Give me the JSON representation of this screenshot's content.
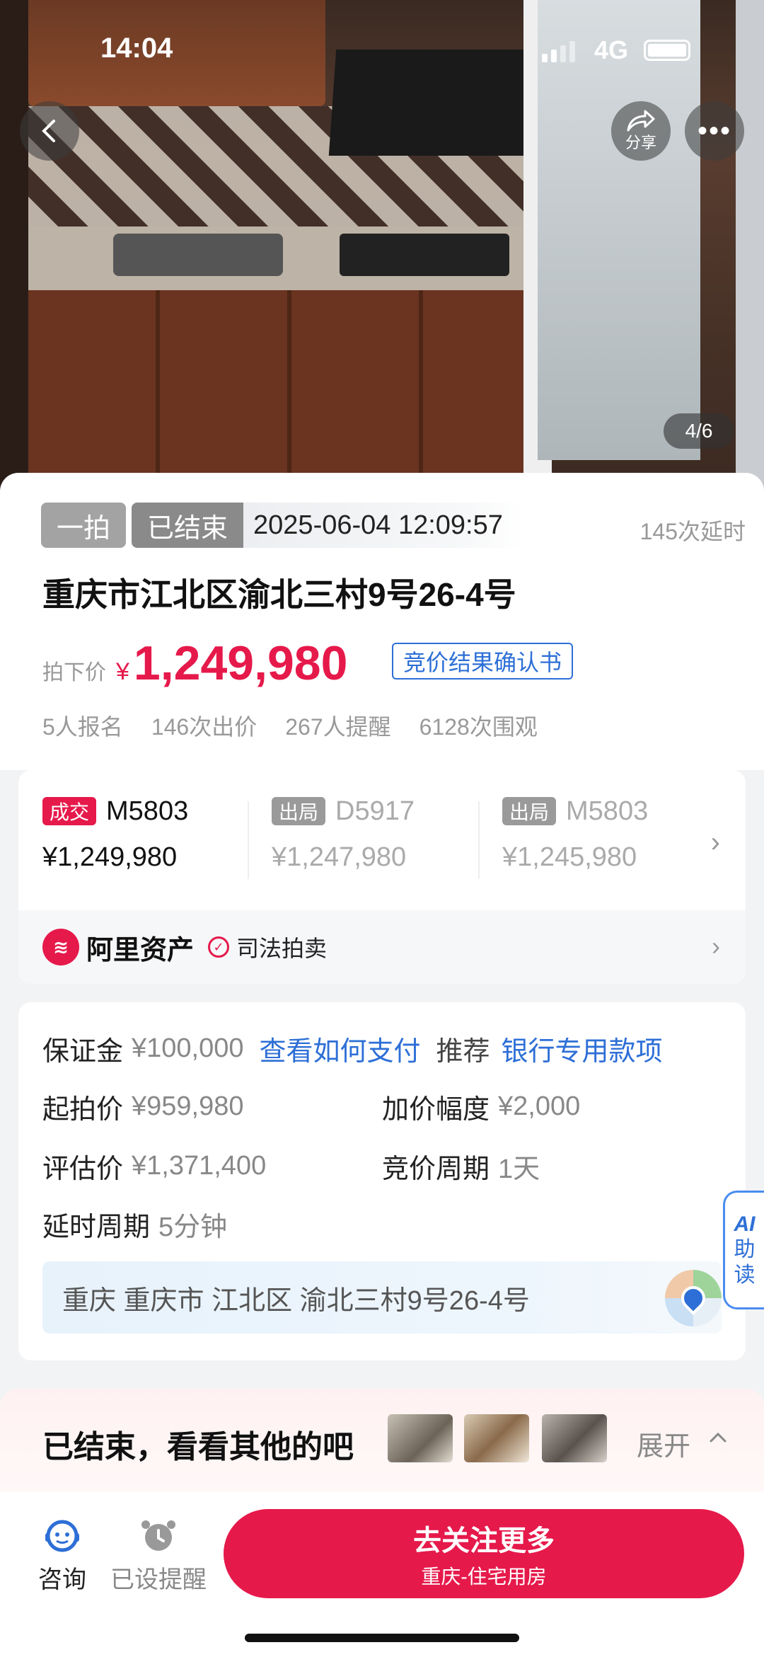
{
  "status_bar": {
    "time": "14:04",
    "network": "4G"
  },
  "hero": {
    "share_label": "分享",
    "more_label": "•••",
    "image_counter": "4/6"
  },
  "auction": {
    "round_tag": "一拍",
    "status_tag": "已结束",
    "end_time": "2025-06-04 12:09:57",
    "delay_count": "145次延时",
    "title": "重庆市江北区渝北三村9号26-4号",
    "price_label": "拍下价",
    "currency": "¥",
    "final_price": "1,249,980",
    "confirm_link": "竞价结果确认书",
    "stats": [
      "5人报名",
      "146次出价",
      "267人提醒",
      "6128次围观"
    ]
  },
  "bids": [
    {
      "badge": "成交",
      "code": "M5803",
      "amount": "¥1,249,980"
    },
    {
      "badge": "出局",
      "code": "D5917",
      "amount": "¥1,247,980"
    },
    {
      "badge": "出局",
      "code": "M5803",
      "amount": "¥1,245,980"
    }
  ],
  "platform": {
    "name": "阿里资产",
    "sub": "司法拍卖"
  },
  "info": {
    "deposit_label": "保证金",
    "deposit_value": "¥100,000",
    "pay_link": "查看如何支付",
    "recommend_label": "推荐",
    "bank_link": "银行专用款项",
    "start_label": "起拍价",
    "start_value": "¥959,980",
    "increment_label": "加价幅度",
    "increment_value": "¥2,000",
    "appraisal_label": "评估价",
    "appraisal_value": "¥1,371,400",
    "period_label": "竞价周期",
    "period_value": "1天",
    "delay_label": "延时周期",
    "delay_value": "5分钟",
    "address": "重庆  重庆市  江北区  渝北三村9号26-4号"
  },
  "ai_tab": {
    "ai": "AI",
    "l1": "助",
    "l2": "读"
  },
  "recommend": {
    "title": "已结束，看看其他的吧",
    "expand": "展开"
  },
  "bottom_bar": {
    "consult": "咨询",
    "reminder": "已设提醒",
    "follow_main": "去关注更多",
    "follow_sub": "重庆-住宅用房"
  },
  "colors": {
    "accent": "#e6194b",
    "link": "#2d6fd6"
  }
}
